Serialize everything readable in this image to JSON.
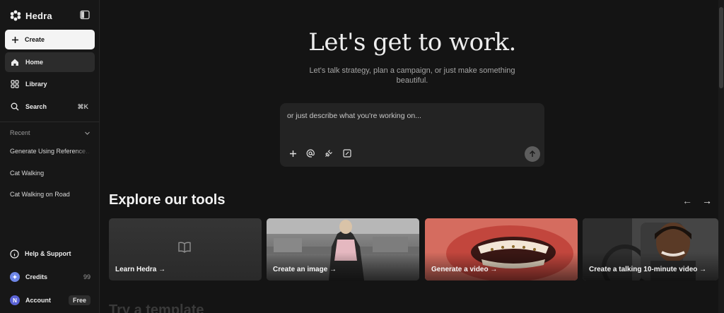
{
  "brand": {
    "name": "Hedra"
  },
  "sidebar": {
    "create_label": "Create",
    "nav": [
      {
        "label": "Home",
        "icon": "home-icon",
        "active": true
      },
      {
        "label": "Library",
        "icon": "grid-icon"
      },
      {
        "label": "Search",
        "icon": "search-icon",
        "shortcut": "⌘K"
      }
    ],
    "recent": {
      "heading": "Recent",
      "items": [
        "Generate Using Reference…",
        "Cat Walking",
        "Cat Walking on Road"
      ]
    },
    "footer": {
      "help_label": "Help & Support",
      "credits_label": "Credits",
      "credits_value": "99",
      "account_label": "Account",
      "account_initial": "N",
      "plan_badge": "Free"
    }
  },
  "hero": {
    "title": "Let's get to work.",
    "subtitle": "Let's talk strategy, plan a campaign, or just make something beautiful."
  },
  "prompt": {
    "placeholder": "or just describe what you're working on..."
  },
  "explore": {
    "title": "Explore our tools",
    "cards": [
      {
        "label": "Learn Hedra →"
      },
      {
        "label": "Create an image →"
      },
      {
        "label": "Generate a video →"
      },
      {
        "label": "Create a talking 10-minute video →"
      }
    ]
  },
  "next_section_title": "Try a template",
  "colors": {
    "accent_avatar": "#5a63d6",
    "credits_icon": "#6e86e6",
    "background": "#141414"
  }
}
